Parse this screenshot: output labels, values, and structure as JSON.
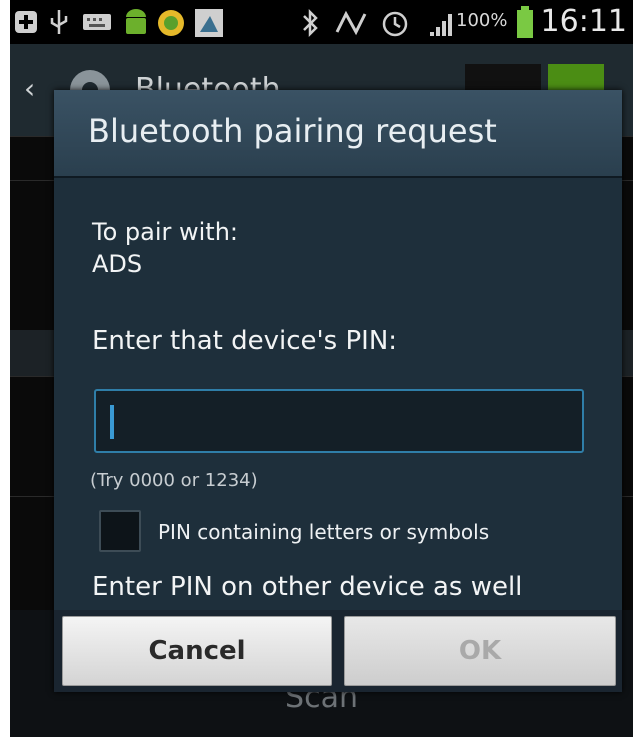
{
  "status_bar": {
    "battery_percent": "100%",
    "time": "16:11",
    "icons": [
      "plus-icon",
      "usb-icon",
      "keyboard-icon",
      "android-icon",
      "game-icon",
      "download-icon",
      "bluetooth-icon",
      "nfc-icon",
      "alarm-icon",
      "signal-icon",
      "battery-icon"
    ]
  },
  "background_app": {
    "title": "Bluetooth",
    "bottom_action": "Scan",
    "switch_on_color": "#4b8d14"
  },
  "dialog": {
    "title": "Bluetooth pairing request",
    "pair_with_label": "To pair with:",
    "device_name": "ADS",
    "pin_prompt": "Enter that device's PIN:",
    "pin_value": "",
    "hint": "(Try 0000 or 1234)",
    "checkbox_label": "PIN containing letters or symbols",
    "checkbox_checked": false,
    "other_device_note": "Enter PIN on other device as well",
    "cancel_label": "Cancel",
    "ok_label": "OK",
    "accent_color": "#2f7ea8"
  }
}
